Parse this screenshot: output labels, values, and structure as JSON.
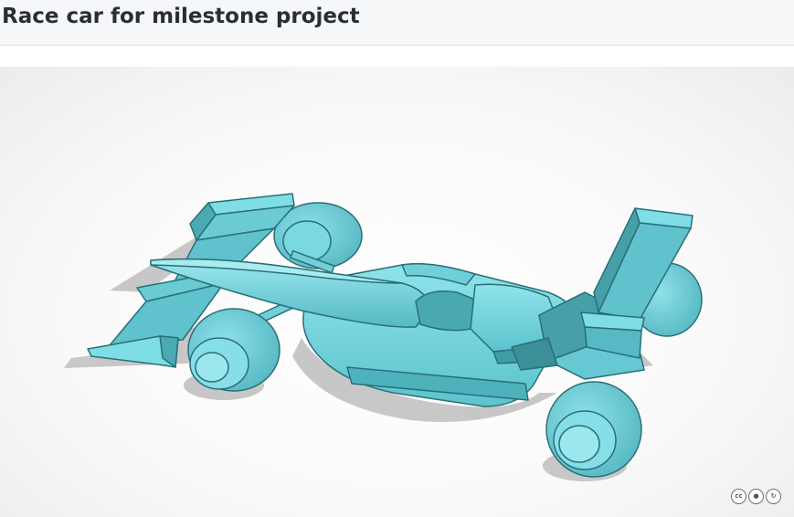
{
  "page": {
    "title": "Race car for milestone project"
  },
  "viewer": {
    "model_color": "#6fd4de",
    "model_edge_color": "#2a6f77",
    "shadow_color": "#bdbdbd",
    "license_icons": [
      {
        "name": "cc-icon",
        "glyph": "cc"
      },
      {
        "name": "by-attribution-icon",
        "glyph": "●"
      },
      {
        "name": "sa-share-alike-icon",
        "glyph": "↻"
      }
    ]
  }
}
